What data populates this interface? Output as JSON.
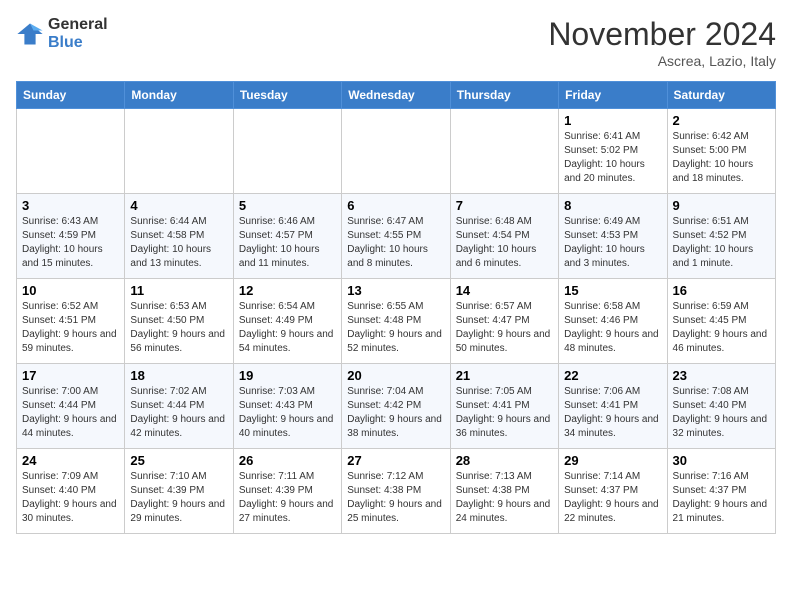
{
  "logo": {
    "line1": "General",
    "line2": "Blue"
  },
  "header": {
    "month": "November 2024",
    "location": "Ascrea, Lazio, Italy"
  },
  "weekdays": [
    "Sunday",
    "Monday",
    "Tuesday",
    "Wednesday",
    "Thursday",
    "Friday",
    "Saturday"
  ],
  "rows": [
    [
      {
        "day": "",
        "info": ""
      },
      {
        "day": "",
        "info": ""
      },
      {
        "day": "",
        "info": ""
      },
      {
        "day": "",
        "info": ""
      },
      {
        "day": "",
        "info": ""
      },
      {
        "day": "1",
        "info": "Sunrise: 6:41 AM\nSunset: 5:02 PM\nDaylight: 10 hours and 20 minutes."
      },
      {
        "day": "2",
        "info": "Sunrise: 6:42 AM\nSunset: 5:00 PM\nDaylight: 10 hours and 18 minutes."
      }
    ],
    [
      {
        "day": "3",
        "info": "Sunrise: 6:43 AM\nSunset: 4:59 PM\nDaylight: 10 hours and 15 minutes."
      },
      {
        "day": "4",
        "info": "Sunrise: 6:44 AM\nSunset: 4:58 PM\nDaylight: 10 hours and 13 minutes."
      },
      {
        "day": "5",
        "info": "Sunrise: 6:46 AM\nSunset: 4:57 PM\nDaylight: 10 hours and 11 minutes."
      },
      {
        "day": "6",
        "info": "Sunrise: 6:47 AM\nSunset: 4:55 PM\nDaylight: 10 hours and 8 minutes."
      },
      {
        "day": "7",
        "info": "Sunrise: 6:48 AM\nSunset: 4:54 PM\nDaylight: 10 hours and 6 minutes."
      },
      {
        "day": "8",
        "info": "Sunrise: 6:49 AM\nSunset: 4:53 PM\nDaylight: 10 hours and 3 minutes."
      },
      {
        "day": "9",
        "info": "Sunrise: 6:51 AM\nSunset: 4:52 PM\nDaylight: 10 hours and 1 minute."
      }
    ],
    [
      {
        "day": "10",
        "info": "Sunrise: 6:52 AM\nSunset: 4:51 PM\nDaylight: 9 hours and 59 minutes."
      },
      {
        "day": "11",
        "info": "Sunrise: 6:53 AM\nSunset: 4:50 PM\nDaylight: 9 hours and 56 minutes."
      },
      {
        "day": "12",
        "info": "Sunrise: 6:54 AM\nSunset: 4:49 PM\nDaylight: 9 hours and 54 minutes."
      },
      {
        "day": "13",
        "info": "Sunrise: 6:55 AM\nSunset: 4:48 PM\nDaylight: 9 hours and 52 minutes."
      },
      {
        "day": "14",
        "info": "Sunrise: 6:57 AM\nSunset: 4:47 PM\nDaylight: 9 hours and 50 minutes."
      },
      {
        "day": "15",
        "info": "Sunrise: 6:58 AM\nSunset: 4:46 PM\nDaylight: 9 hours and 48 minutes."
      },
      {
        "day": "16",
        "info": "Sunrise: 6:59 AM\nSunset: 4:45 PM\nDaylight: 9 hours and 46 minutes."
      }
    ],
    [
      {
        "day": "17",
        "info": "Sunrise: 7:00 AM\nSunset: 4:44 PM\nDaylight: 9 hours and 44 minutes."
      },
      {
        "day": "18",
        "info": "Sunrise: 7:02 AM\nSunset: 4:44 PM\nDaylight: 9 hours and 42 minutes."
      },
      {
        "day": "19",
        "info": "Sunrise: 7:03 AM\nSunset: 4:43 PM\nDaylight: 9 hours and 40 minutes."
      },
      {
        "day": "20",
        "info": "Sunrise: 7:04 AM\nSunset: 4:42 PM\nDaylight: 9 hours and 38 minutes."
      },
      {
        "day": "21",
        "info": "Sunrise: 7:05 AM\nSunset: 4:41 PM\nDaylight: 9 hours and 36 minutes."
      },
      {
        "day": "22",
        "info": "Sunrise: 7:06 AM\nSunset: 4:41 PM\nDaylight: 9 hours and 34 minutes."
      },
      {
        "day": "23",
        "info": "Sunrise: 7:08 AM\nSunset: 4:40 PM\nDaylight: 9 hours and 32 minutes."
      }
    ],
    [
      {
        "day": "24",
        "info": "Sunrise: 7:09 AM\nSunset: 4:40 PM\nDaylight: 9 hours and 30 minutes."
      },
      {
        "day": "25",
        "info": "Sunrise: 7:10 AM\nSunset: 4:39 PM\nDaylight: 9 hours and 29 minutes."
      },
      {
        "day": "26",
        "info": "Sunrise: 7:11 AM\nSunset: 4:39 PM\nDaylight: 9 hours and 27 minutes."
      },
      {
        "day": "27",
        "info": "Sunrise: 7:12 AM\nSunset: 4:38 PM\nDaylight: 9 hours and 25 minutes."
      },
      {
        "day": "28",
        "info": "Sunrise: 7:13 AM\nSunset: 4:38 PM\nDaylight: 9 hours and 24 minutes."
      },
      {
        "day": "29",
        "info": "Sunrise: 7:14 AM\nSunset: 4:37 PM\nDaylight: 9 hours and 22 minutes."
      },
      {
        "day": "30",
        "info": "Sunrise: 7:16 AM\nSunset: 4:37 PM\nDaylight: 9 hours and 21 minutes."
      }
    ]
  ]
}
